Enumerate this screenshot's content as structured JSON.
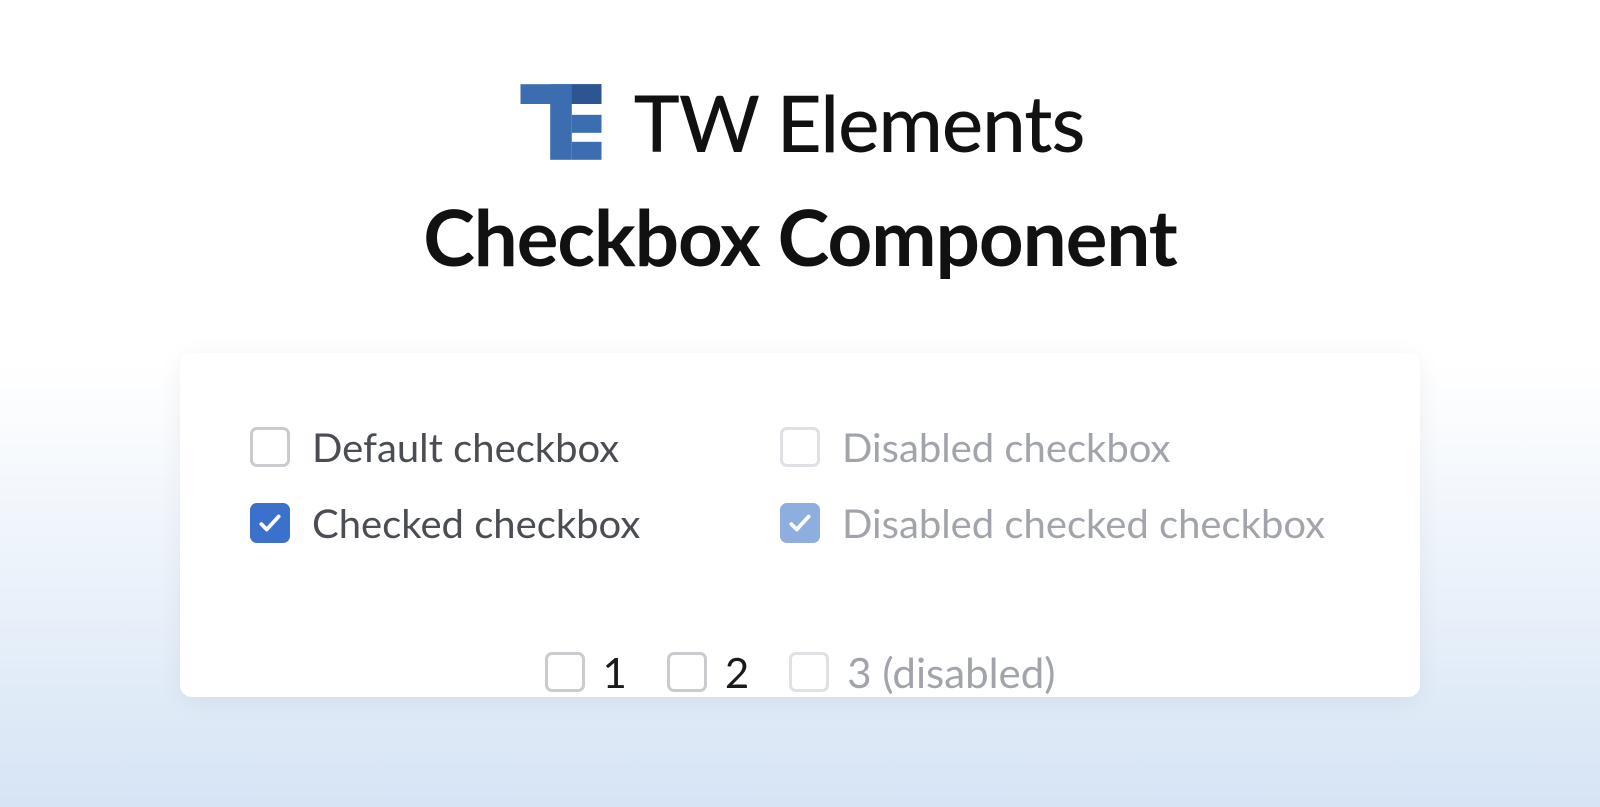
{
  "brand": {
    "name": "TW Elements",
    "logo_color_main": "#3b6db0",
    "logo_color_dark": "#2d5590"
  },
  "subtitle": "Checkbox Component",
  "checkboxes": {
    "default": {
      "label": "Default checkbox",
      "checked": false,
      "disabled": false
    },
    "checked": {
      "label": "Checked checkbox",
      "checked": true,
      "disabled": false
    },
    "disabled": {
      "label": "Disabled checkbox",
      "checked": false,
      "disabled": true
    },
    "disabled_checked": {
      "label": "Disabled checked checkbox",
      "checked": true,
      "disabled": true
    }
  },
  "inline": [
    {
      "label": "1",
      "checked": false,
      "disabled": false
    },
    {
      "label": "2",
      "checked": false,
      "disabled": false
    },
    {
      "label": "3 (disabled)",
      "checked": false,
      "disabled": true
    }
  ],
  "colors": {
    "primary": "#3b71ca",
    "primary_disabled": "#8faee0",
    "text": "#4a4d52",
    "text_disabled": "#a1a5ab",
    "border": "#c9cbce",
    "border_disabled": "#dfe1e4"
  }
}
